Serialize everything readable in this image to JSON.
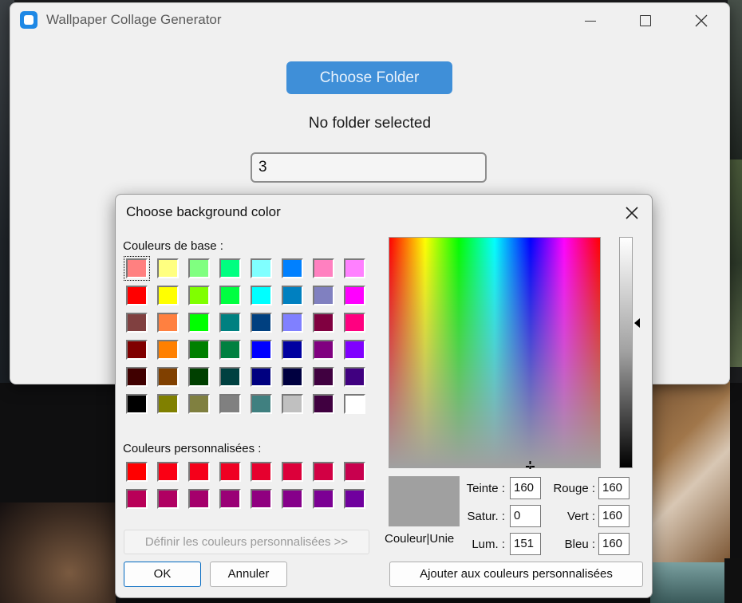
{
  "window": {
    "title": "Wallpaper Collage Generator",
    "choose_folder_label": "Choose Folder",
    "folder_status": "No folder selected",
    "count_value": "3"
  },
  "dialog": {
    "title": "Choose background color",
    "basic_label": "Couleurs de base :",
    "custom_label": "Couleurs personnalisées :",
    "basic_colors": [
      "#ff8080",
      "#ffff80",
      "#80ff80",
      "#00ff80",
      "#80ffff",
      "#0080ff",
      "#ff80c0",
      "#ff80ff",
      "#ff0000",
      "#ffff00",
      "#80ff00",
      "#00ff40",
      "#00ffff",
      "#0080c0",
      "#8080c0",
      "#ff00ff",
      "#804040",
      "#ff8040",
      "#00ff00",
      "#008080",
      "#004080",
      "#8080ff",
      "#800040",
      "#ff0080",
      "#800000",
      "#ff8000",
      "#008000",
      "#008040",
      "#0000ff",
      "#0000a0",
      "#800080",
      "#8000ff",
      "#400000",
      "#804000",
      "#004000",
      "#004040",
      "#000080",
      "#000040",
      "#400040",
      "#400080",
      "#000000",
      "#808000",
      "#808040",
      "#808080",
      "#408080",
      "#c0c0c0",
      "#400040",
      "#ffffff"
    ],
    "custom_colors": [
      "#ff0000",
      "#fa0014",
      "#f5001a",
      "#ef0022",
      "#e6002e",
      "#dc003a",
      "#d20044",
      "#c8004e",
      "#b90058",
      "#b00062",
      "#a5006c",
      "#9a0076",
      "#900080",
      "#86008a",
      "#7c0094",
      "#70009e"
    ],
    "define_custom_label": "Définir les couleurs personnalisées >>",
    "ok_label": "OK",
    "cancel_label": "Annuler",
    "add_custom_label": "Ajouter aux couleurs personnalisées",
    "preview_label": "Couleur|Unie",
    "preview_color": "#a0a0a0",
    "fields": {
      "hue_label": "Teinte :",
      "hue_value": "160",
      "sat_label": "Satur. :",
      "sat_value": "0",
      "lum_label": "Lum. :",
      "lum_value": "151",
      "red_label": "Rouge :",
      "red_value": "160",
      "green_label": "Vert :",
      "green_value": "160",
      "blue_label": "Bleu :",
      "blue_value": "160"
    }
  }
}
